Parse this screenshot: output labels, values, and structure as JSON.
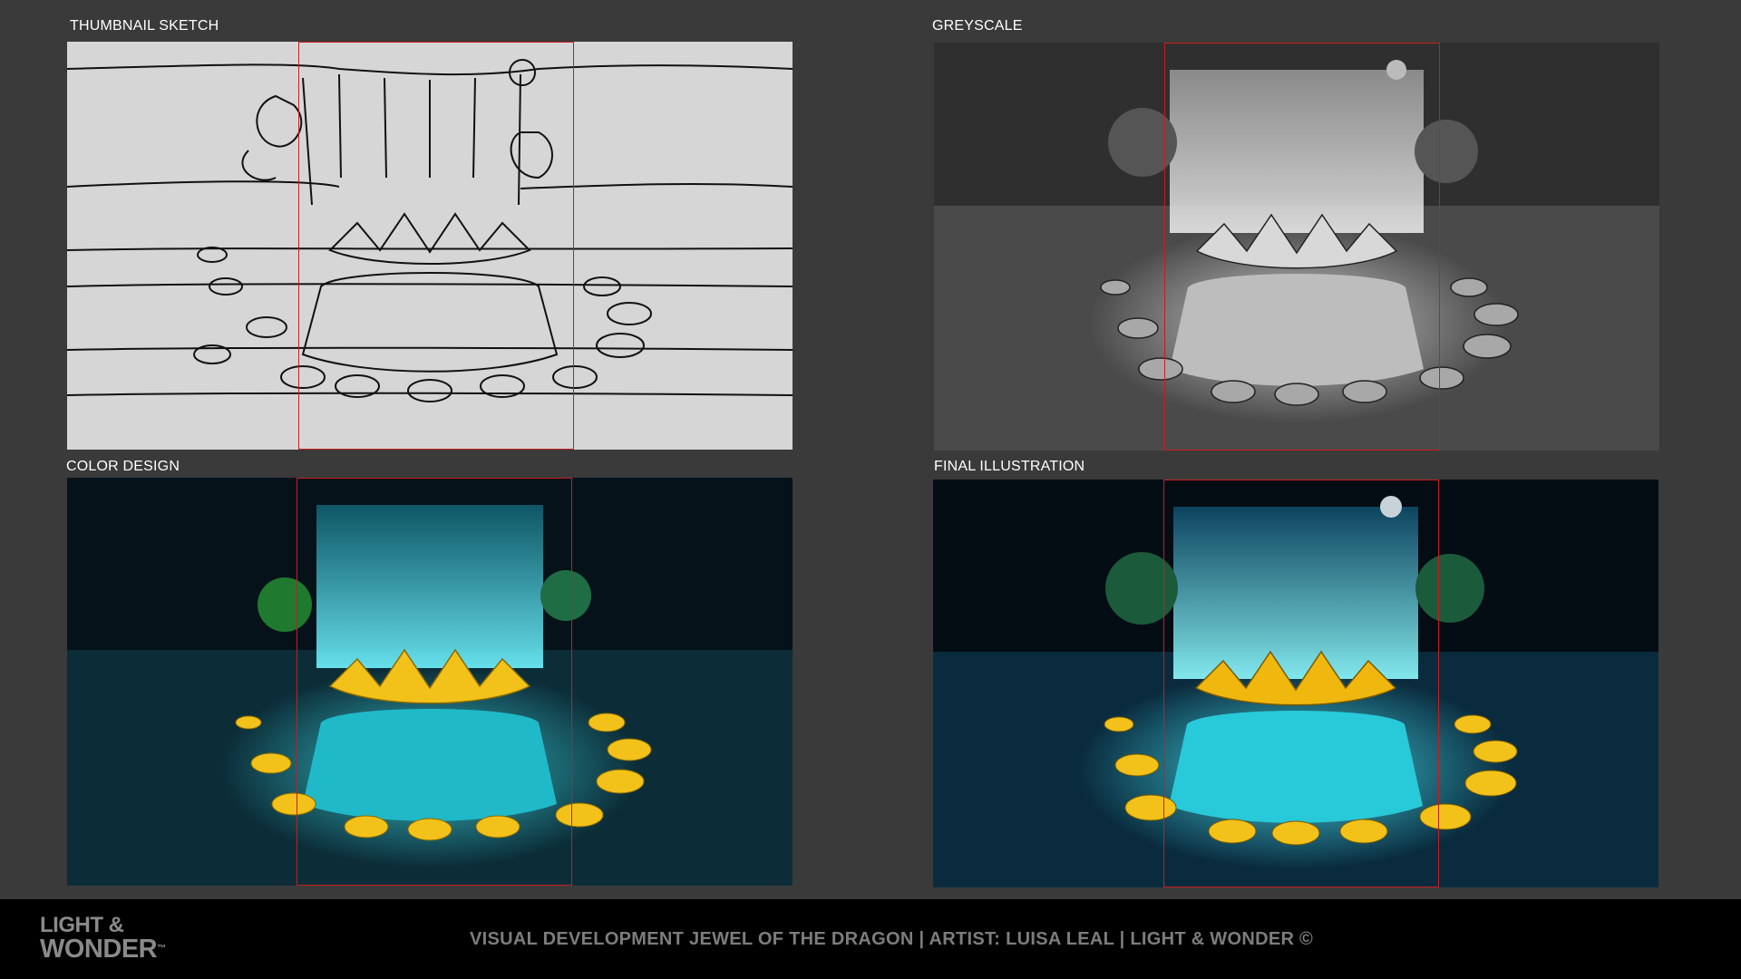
{
  "panels": {
    "thumbnail": {
      "label": "THUMBNAIL SKETCH"
    },
    "greyscale": {
      "label": "GREYSCALE"
    },
    "color": {
      "label": "COLOR DESIGN"
    },
    "final": {
      "label": "FINAL ILLUSTRATION"
    }
  },
  "footer": {
    "logo_line1": "LIGHT &",
    "logo_line2": "WONDER",
    "logo_mark": "™",
    "credits": "VISUAL DEVELOPMENT JEWEL OF THE DRAGON | ARTIST: LUISA LEAL | LIGHT & WONDER ©"
  },
  "colors": {
    "background": "#3a3a3a",
    "footer": "#000000",
    "crop_frame": "#c81d1d",
    "gold": "#f2c21b",
    "water_glow": "#3fe6f0"
  }
}
